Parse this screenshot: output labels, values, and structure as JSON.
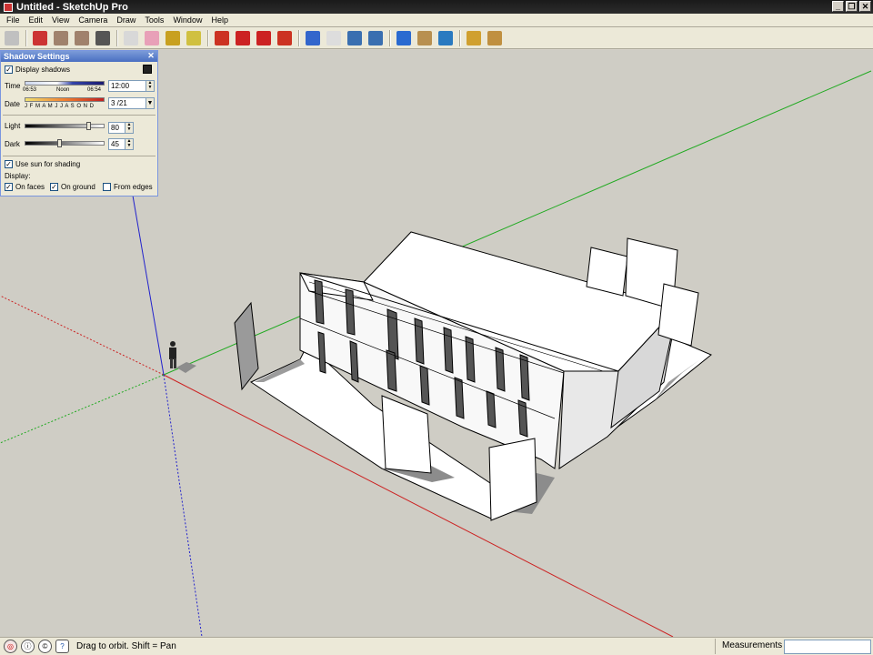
{
  "window": {
    "title": "Untitled - SketchUp Pro",
    "minimize_glyph": "_",
    "restore_glyph": "❐",
    "close_glyph": "✕"
  },
  "menu": [
    "File",
    "Edit",
    "View",
    "Camera",
    "Draw",
    "Tools",
    "Window",
    "Help"
  ],
  "toolbar": {
    "tools": [
      {
        "name": "select-icon",
        "color": "#c0c0c0"
      },
      {
        "name": "pencil-icon",
        "color": "#cc3333"
      },
      {
        "name": "rectangle-icon",
        "color": "#a0826d"
      },
      {
        "name": "circle-icon",
        "color": "#a0826d"
      },
      {
        "name": "arc-icon",
        "color": "#555555"
      },
      {
        "name": "make-component-icon",
        "color": "#d8d8d8"
      },
      {
        "name": "eraser-icon",
        "color": "#e8a0b8"
      },
      {
        "name": "paint-bucket-icon",
        "color": "#c8a020"
      },
      {
        "name": "tape-measure-icon",
        "color": "#d0c040"
      },
      {
        "name": "push-pull-icon",
        "color": "#cc3322"
      },
      {
        "name": "move-icon",
        "color": "#cc2222"
      },
      {
        "name": "rotate-icon",
        "color": "#cc2222"
      },
      {
        "name": "offset-icon",
        "color": "#cc3322"
      },
      {
        "name": "orbit-icon",
        "color": "#3366cc"
      },
      {
        "name": "pan-icon",
        "color": "#dddddd"
      },
      {
        "name": "zoom-icon",
        "color": "#3a6fb0"
      },
      {
        "name": "zoom-extents-icon",
        "color": "#3a6fb0"
      },
      {
        "name": "get-models-icon",
        "color": "#2a6ad0"
      },
      {
        "name": "share-model-icon",
        "color": "#b89050"
      },
      {
        "name": "google-earth-icon",
        "color": "#2a7ac0"
      },
      {
        "name": "get-components-icon",
        "color": "#d0a030"
      },
      {
        "name": "share-component-icon",
        "color": "#c09040"
      }
    ]
  },
  "shadow_settings": {
    "title": "Shadow Settings",
    "display_shadows_label": "Display shadows",
    "display_shadows_checked": true,
    "time_label": "Time",
    "time_start": "06:53",
    "time_noon": "Noon",
    "time_end": "06:54",
    "time_value": "12:00",
    "date_label": "Date",
    "months": "J F M A M J J A S O N D",
    "date_value": "3 /21",
    "light_label": "Light",
    "light_value": "80",
    "dark_label": "Dark",
    "dark_value": "45",
    "use_sun_label": "Use sun for shading",
    "use_sun_checked": true,
    "display_label": "Display:",
    "on_faces_label": "On faces",
    "on_faces_checked": true,
    "on_ground_label": "On ground",
    "on_ground_checked": true,
    "from_edges_label": "From edges",
    "from_edges_checked": false,
    "check_glyph": "✓",
    "close_glyph": "✕"
  },
  "status": {
    "hint": "Drag to orbit.  Shift = Pan",
    "measurements_label": "Measurements",
    "measurements_value": ""
  },
  "colors": {
    "red_axis": "#cc2222",
    "green_axis": "#22aa22",
    "blue_axis": "#2222cc",
    "ground": "#cfcdc5",
    "face": "#ffffff",
    "shadow": "#8c8c8c"
  }
}
